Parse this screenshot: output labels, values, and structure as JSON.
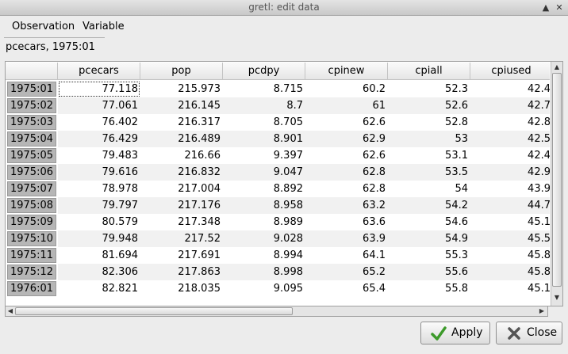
{
  "window": {
    "title": "gretl: edit data"
  },
  "menu": [
    "Observation",
    "Variable"
  ],
  "cell_ref": "pcecars, 1975:01",
  "columns": [
    "pcecars",
    "pop",
    "pcdpy",
    "cpinew",
    "cpiall",
    "cpiused"
  ],
  "rows": [
    {
      "label": "1975:01",
      "values": [
        "77.118",
        "215.973",
        "8.715",
        "60.2",
        "52.3",
        "42.4"
      ]
    },
    {
      "label": "1975:02",
      "values": [
        "77.061",
        "216.145",
        "8.7",
        "61",
        "52.6",
        "42.7"
      ]
    },
    {
      "label": "1975:03",
      "values": [
        "76.402",
        "216.317",
        "8.705",
        "62.6",
        "52.8",
        "42.8"
      ]
    },
    {
      "label": "1975:04",
      "values": [
        "76.429",
        "216.489",
        "8.901",
        "62.9",
        "53",
        "42.5"
      ]
    },
    {
      "label": "1975:05",
      "values": [
        "79.483",
        "216.66",
        "9.397",
        "62.6",
        "53.1",
        "42.4"
      ]
    },
    {
      "label": "1975:06",
      "values": [
        "79.616",
        "216.832",
        "9.047",
        "62.8",
        "53.5",
        "42.9"
      ]
    },
    {
      "label": "1975:07",
      "values": [
        "78.978",
        "217.004",
        "8.892",
        "62.8",
        "54",
        "43.9"
      ]
    },
    {
      "label": "1975:08",
      "values": [
        "79.797",
        "217.176",
        "8.958",
        "63.2",
        "54.2",
        "44.7"
      ]
    },
    {
      "label": "1975:09",
      "values": [
        "80.579",
        "217.348",
        "8.989",
        "63.6",
        "54.6",
        "45.1"
      ]
    },
    {
      "label": "1975:10",
      "values": [
        "79.948",
        "217.52",
        "9.028",
        "63.9",
        "54.9",
        "45.5"
      ]
    },
    {
      "label": "1975:11",
      "values": [
        "81.694",
        "217.691",
        "8.994",
        "64.1",
        "55.3",
        "45.8"
      ]
    },
    {
      "label": "1975:12",
      "values": [
        "82.306",
        "217.863",
        "8.998",
        "65.2",
        "55.6",
        "45.8"
      ]
    },
    {
      "label": "1976:01",
      "values": [
        "82.821",
        "218.035",
        "9.095",
        "65.4",
        "55.8",
        "45.1"
      ]
    }
  ],
  "buttons": {
    "apply": "Apply",
    "close": "Close"
  },
  "icons": {
    "apply": "checkmark-icon",
    "close": "x-icon",
    "window_up": "up-arrow-icon",
    "window_close": "close-icon"
  }
}
